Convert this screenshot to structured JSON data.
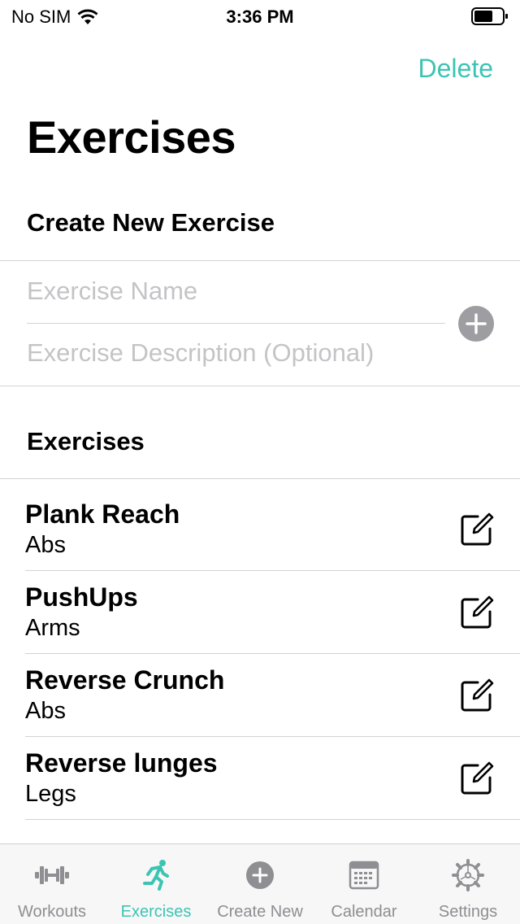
{
  "status_bar": {
    "carrier": "No SIM",
    "time": "3:36 PM"
  },
  "nav": {
    "delete_label": "Delete",
    "title": "Exercises"
  },
  "create_section": {
    "header": "Create New Exercise",
    "name_placeholder": "Exercise Name",
    "description_placeholder": "Exercise Description (Optional)",
    "add_icon": "plus-circle-icon"
  },
  "list_section": {
    "header": "Exercises",
    "items": [
      {
        "name": "Plank Reach",
        "category": "Abs",
        "icon": "edit-icon"
      },
      {
        "name": "PushUps",
        "category": "Arms",
        "icon": "edit-icon"
      },
      {
        "name": "Reverse Crunch",
        "category": "Abs",
        "icon": "edit-icon"
      },
      {
        "name": "Reverse lunges",
        "category": "Legs",
        "icon": "edit-icon"
      }
    ]
  },
  "tab_bar": {
    "active_color": "#3cc4b3",
    "inactive_color": "#8e8e93",
    "tabs": [
      {
        "label": "Workouts",
        "icon": "dumbbell-icon",
        "active": false
      },
      {
        "label": "Exercises",
        "icon": "runner-icon",
        "active": true
      },
      {
        "label": "Create New",
        "icon": "plus-circle-icon",
        "active": false
      },
      {
        "label": "Calendar",
        "icon": "calendar-icon",
        "active": false
      },
      {
        "label": "Settings",
        "icon": "gear-icon",
        "active": false
      }
    ]
  }
}
